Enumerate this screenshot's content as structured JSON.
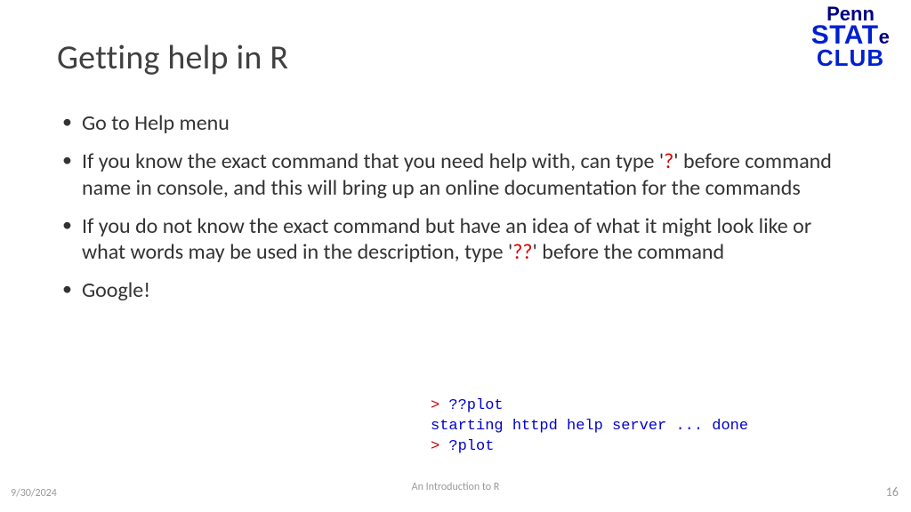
{
  "title": "Getting help in R",
  "logo": {
    "line1": "Penn",
    "line2a": "STAT",
    "line2b": "e",
    "line3": "CLUB"
  },
  "bullets": {
    "b1": "Go to Help menu",
    "b2a": "If you know the exact command that you need help with, can type '",
    "b2q": "?",
    "b2b": "' before command name in console, and this will bring up an online documentation for the commands",
    "b3a": "If you do not know the exact command but have an idea of what it might look like or what words may be used in the description, type '",
    "b3q": "??",
    "b3b": "' before the command",
    "b4": "Google!"
  },
  "console": {
    "l1a": "> ",
    "l1b": "??plot",
    "l2": "starting httpd help server ... done",
    "l3a": "> ",
    "l3b": "?plot"
  },
  "footer": {
    "date": "9/30/2024",
    "title": "An Introduction to R",
    "page": "16"
  }
}
